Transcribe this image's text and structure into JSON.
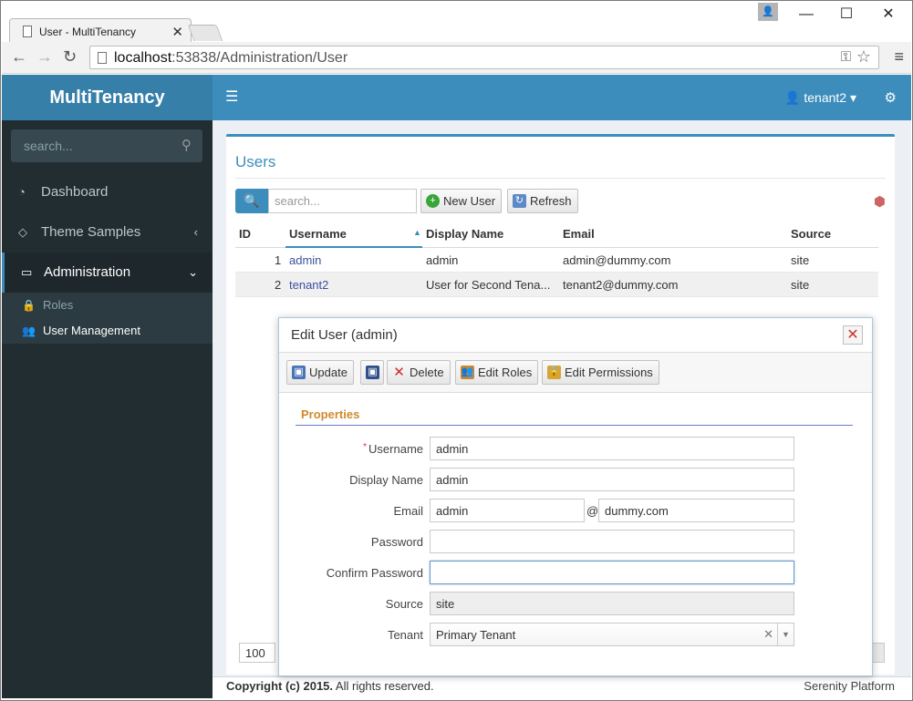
{
  "browser": {
    "tab_title": "User - MultiTenancy",
    "tab_close": "✕",
    "window_controls": {
      "minimize": "—",
      "maximize": "☐",
      "close": "✕"
    },
    "url_host": "localhost",
    "url_rest": ":53838/Administration/User"
  },
  "app": {
    "brand": "MultiTenancy",
    "user_menu": "tenant2"
  },
  "sidebar": {
    "search_placeholder": "search...",
    "items": [
      {
        "label": "Dashboard",
        "icon": "dashboard-icon"
      },
      {
        "label": "Theme Samples",
        "icon": "diamond-icon"
      },
      {
        "label": "Administration",
        "icon": "desktop-icon"
      }
    ],
    "subitems": [
      {
        "label": "Roles",
        "icon": "lock-icon"
      },
      {
        "label": "User Management",
        "icon": "users-icon"
      }
    ]
  },
  "users_panel": {
    "title": "Users",
    "search_placeholder": "search...",
    "new_user_label": "New User",
    "refresh_label": "Refresh",
    "columns": [
      "ID",
      "Username",
      "Display Name",
      "Email",
      "Source"
    ],
    "rows": [
      {
        "id": "1",
        "username": "admin",
        "display_name": "admin",
        "email": "admin@dummy.com",
        "source": "site"
      },
      {
        "id": "2",
        "username": "tenant2",
        "display_name": "User for Second Tena...",
        "email": "tenant2@dummy.com",
        "source": "site"
      }
    ],
    "page_size": "100"
  },
  "dialog": {
    "title": "Edit User (admin)",
    "toolbar": {
      "update": "Update",
      "delete": "Delete",
      "edit_roles": "Edit Roles",
      "edit_permissions": "Edit Permissions"
    },
    "section": "Properties",
    "fields": {
      "username_label": "Username",
      "username_value": "admin",
      "display_name_label": "Display Name",
      "display_name_value": "admin",
      "email_label": "Email",
      "email_user": "admin",
      "email_at": "@",
      "email_domain": "dummy.com",
      "password_label": "Password",
      "password_value": "",
      "confirm_password_label": "Confirm Password",
      "confirm_password_value": "",
      "source_label": "Source",
      "source_value": "site",
      "tenant_label": "Tenant",
      "tenant_value": "Primary Tenant"
    }
  },
  "footer": {
    "copyright_bold": "Copyright (c) 2015.",
    "copyright_rest": " All rights reserved.",
    "platform": "Serenity Platform"
  },
  "colors": {
    "brand_dark": "#367fa9",
    "brand": "#3c8dbc",
    "sidebar_bg": "#222d32",
    "section_title": "#d08a2c"
  }
}
